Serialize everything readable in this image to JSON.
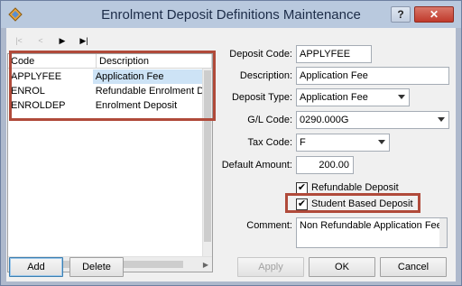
{
  "window": {
    "title": "Enrolment Deposit Definitions Maintenance",
    "help_label": "?",
    "close_label": "✕"
  },
  "navbar": {
    "first": "|<",
    "prev": "<",
    "next": "▶",
    "last": "▶|"
  },
  "grid": {
    "columns": [
      "Code",
      "Description"
    ],
    "rows": [
      {
        "code": "APPLYFEE",
        "description": "Application Fee"
      },
      {
        "code": "ENROL",
        "description": "Refundable Enrolment D"
      },
      {
        "code": "ENROLDEP",
        "description": "Enrolment Deposit"
      }
    ]
  },
  "form": {
    "deposit_code_label": "Deposit Code:",
    "deposit_code": "APPLYFEE",
    "description_label": "Description:",
    "description": "Application Fee",
    "deposit_type_label": "Deposit Type:",
    "deposit_type": "Application Fee",
    "gl_code_label": "G/L Code:",
    "gl_code": "0290.000G",
    "tax_code_label": "Tax Code:",
    "tax_code": "F",
    "default_amount_label": "Default Amount:",
    "default_amount": "200.00",
    "refundable_label": "Refundable Deposit",
    "refundable_checked": true,
    "student_based_label": "Student Based Deposit",
    "student_based_checked": true,
    "comment_label": "Comment:",
    "comment": "Non Refundable Application Fee"
  },
  "buttons": {
    "add": "Add",
    "delete": "Delete",
    "apply": "Apply",
    "ok": "OK",
    "cancel": "Cancel"
  },
  "colors": {
    "highlight_box": "#b04a3a",
    "selection": "#cde3f6",
    "title_bar": "#b9c9de"
  }
}
